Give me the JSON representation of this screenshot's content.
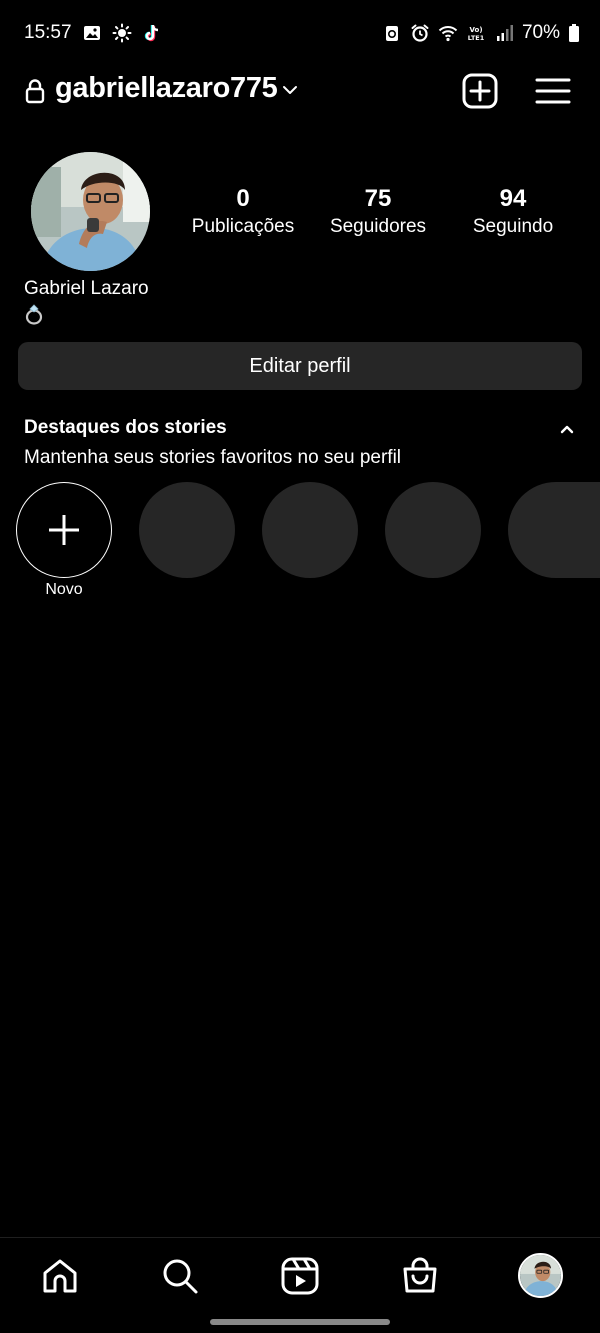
{
  "status_bar": {
    "time": "15:57",
    "battery": "70%",
    "left_icons": [
      "image-icon",
      "brightness-icon",
      "tiktok-icon"
    ],
    "right_icons": [
      "recycle-icon",
      "alarm-icon",
      "wifi-icon",
      "volte-icon",
      "signal-icon",
      "battery-icon"
    ]
  },
  "header": {
    "username": "gabriellazaro775"
  },
  "profile": {
    "display_name": "Gabriel Lazaro",
    "stats": [
      {
        "value": "0",
        "label": "Publicações"
      },
      {
        "value": "75",
        "label": "Seguidores"
      },
      {
        "value": "94",
        "label": "Seguindo"
      }
    ],
    "edit_label": "Editar perfil"
  },
  "highlights": {
    "title": "Destaques dos stories",
    "subtitle": "Mantenha seus stories favoritos no seu perfil",
    "new_label": "Novo"
  },
  "colors": {
    "background": "#000000",
    "button_bg": "#262626",
    "placeholder": "#262626",
    "text": "#ffffff"
  }
}
